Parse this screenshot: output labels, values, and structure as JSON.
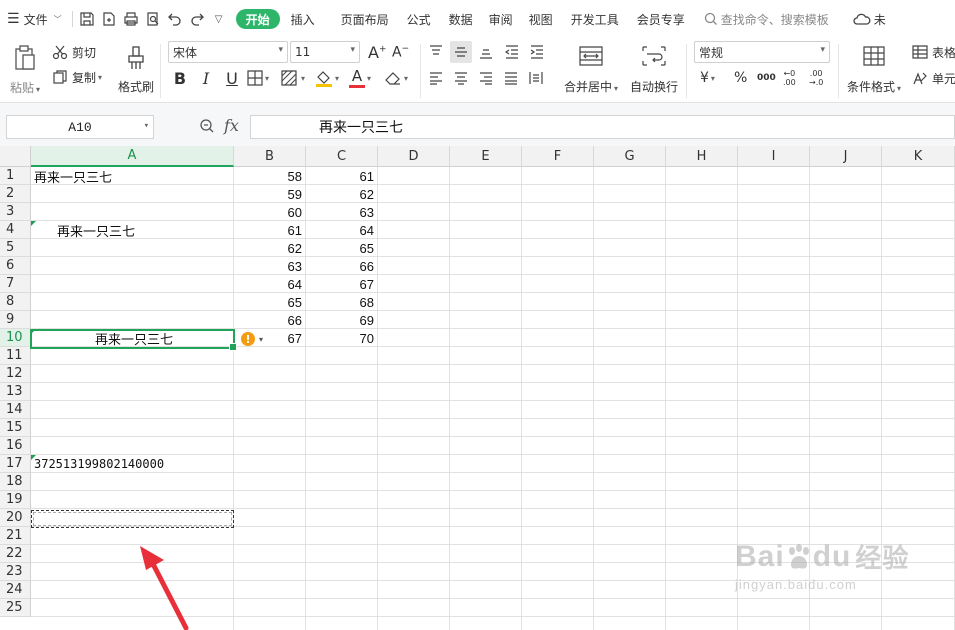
{
  "menubar": {
    "file_label": "文件",
    "tabs": [
      "开始",
      "插入",
      "页面布局",
      "公式",
      "数据",
      "审阅",
      "视图",
      "开发工具",
      "会员专享"
    ],
    "search_label": "查找命令、搜索模板",
    "cloud_label": "未"
  },
  "ribbon": {
    "paste": "粘贴",
    "cut": "剪切",
    "copy": "复制",
    "format_painter": "格式刷",
    "font_name": "宋体",
    "font_size": "11",
    "bold": "B",
    "italic": "I",
    "underline": "U",
    "font_color_glyph": "A",
    "merge_center": "合并居中",
    "wrap_text": "自动换行",
    "number_format": "常规",
    "currency_glyph": "¥",
    "percent_glyph": "%",
    "thousands_glyph": "000",
    "inc_decimal_top": "←0",
    "inc_decimal_bottom": ".00",
    "dec_decimal_top": ".00",
    "dec_decimal_bottom": "→.0",
    "conditional_format": "条件格式",
    "table_style": "表格",
    "cell_style": "单元"
  },
  "formula_bar": {
    "name_box": "A10",
    "fx": "fx",
    "content": "再来一只三七"
  },
  "grid": {
    "columns": [
      "A",
      "B",
      "C",
      "D",
      "E",
      "F",
      "G",
      "H",
      "I",
      "J",
      "K"
    ],
    "rows": [
      "1",
      "2",
      "3",
      "4",
      "5",
      "6",
      "7",
      "8",
      "9",
      "10",
      "11",
      "12",
      "13",
      "14",
      "15",
      "16",
      "17",
      "18",
      "19",
      "20",
      "21",
      "22",
      "23",
      "24",
      "25"
    ],
    "selected_column": "A",
    "selected_row": "10",
    "cells": {
      "A1": "再来一只三七",
      "A4": "再来一只三七",
      "A10": "再来一只三七",
      "A17": "372513199802140000"
    },
    "col_b": [
      "58",
      "59",
      "60",
      "61",
      "62",
      "63",
      "64",
      "65",
      "66",
      "67"
    ],
    "col_c": [
      "61",
      "62",
      "63",
      "64",
      "65",
      "66",
      "67",
      "68",
      "69",
      "70"
    ],
    "warn_glyph": "!"
  },
  "watermark": {
    "main": "Bai",
    "du": "du",
    "exp": "经验",
    "sub": "jingyan.baidu.com"
  },
  "colors": {
    "accent": "#2db56a",
    "selection": "#21a35a",
    "arrow": "#e8303a",
    "warning": "#f39c12"
  }
}
